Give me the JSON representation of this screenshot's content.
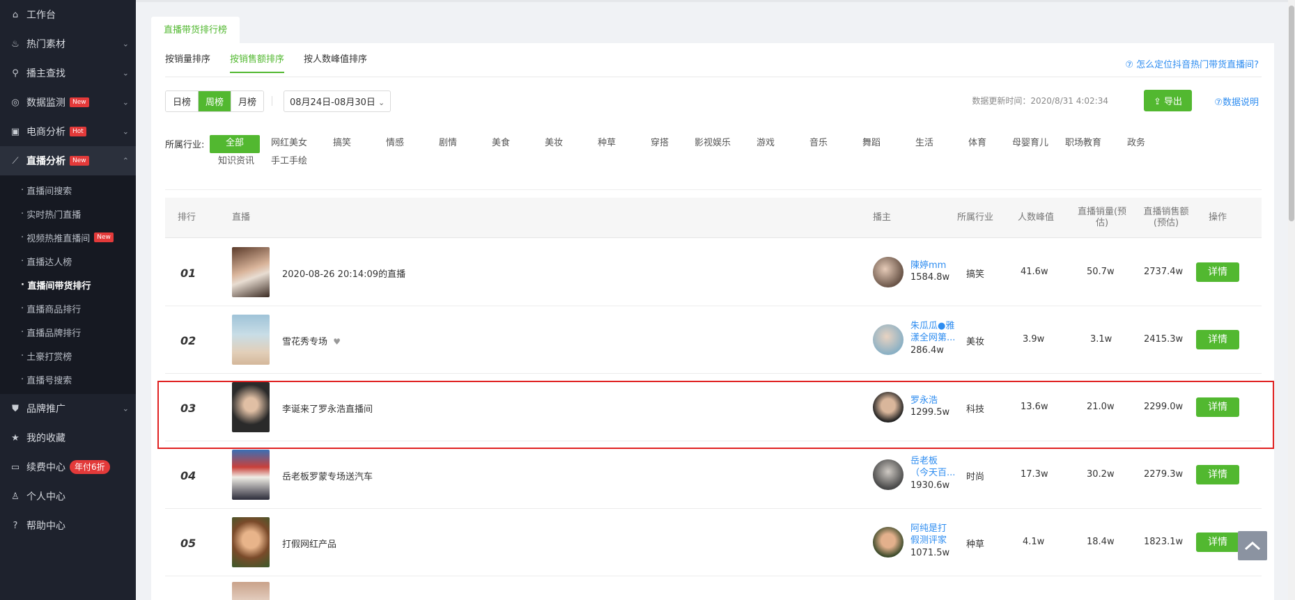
{
  "sidebar": {
    "workspace": "工作台",
    "hot_material": "热门素材",
    "anchor_search": "播主查找",
    "data_monitor": "数据监测",
    "data_monitor_badge": "New",
    "ecom_analysis": "电商分析",
    "ecom_badge": "Hot",
    "live_analysis": "直播分析",
    "live_badge": "New",
    "sub_items": [
      "直播间搜索",
      "实时热门直播",
      "视频热推直播间",
      "直播达人榜",
      "直播间带货排行",
      "直播商品排行",
      "直播品牌排行",
      "土豪打赏榜",
      "直播号搜索"
    ],
    "sub_badge": "New",
    "brand_promo": "品牌推广",
    "favorites": "我的收藏",
    "renew": "续费中心",
    "renew_badge": "年付6折",
    "personal": "个人中心",
    "help": "帮助中心"
  },
  "page": {
    "top_tab": "直播带货排行榜",
    "sort_tabs": [
      "按销量排序",
      "按销售额排序",
      "按人数峰值排序"
    ],
    "howto_link": "⑦ 怎么定位抖音热门带货直播间?",
    "period_buttons": [
      "日榜",
      "周榜",
      "月榜"
    ],
    "date_range": "08月24日-08月30日",
    "update_time": "数据更新时间：2020/8/31 4:02:34",
    "export_label": "导出",
    "explain_link": "⑦数据说明",
    "industry_label": "所属行业:",
    "industries": [
      "全部",
      "网红美女",
      "搞笑",
      "情感",
      "剧情",
      "美食",
      "美妆",
      "种草",
      "穿搭",
      "影视娱乐",
      "游戏",
      "音乐",
      "舞蹈",
      "生活",
      "体育",
      "母婴育儿",
      "职场教育",
      "政务",
      "知识资讯",
      "手工手绘"
    ]
  },
  "table": {
    "headers": {
      "rank": "排行",
      "live": "直播",
      "anchor": "播主",
      "industry": "所属行业",
      "peak": "人数峰值",
      "sales_line1": "直播销量(预",
      "sales_line2": "估)",
      "amount_line1": "直播销售额",
      "amount_line2": "(预估)",
      "op": "操作"
    },
    "detail_label": "详情",
    "rows": [
      {
        "rank": "01",
        "title": "2020-08-26 20:14:09的直播",
        "anchor_l1": "陳婷mm",
        "anchor_l2": "",
        "fans": "1584.8w",
        "industry": "搞笑",
        "peak": "41.6w",
        "sales": "50.7w",
        "amount": "2737.4w"
      },
      {
        "rank": "02",
        "title": "雪花秀专场",
        "anchor_l1": "朱瓜瓜●雅",
        "anchor_l2": "漾全网第...",
        "fans": "286.4w",
        "industry": "美妆",
        "peak": "3.9w",
        "sales": "3.1w",
        "amount": "2415.3w"
      },
      {
        "rank": "03",
        "title": "李诞来了罗永浩直播间",
        "anchor_l1": "罗永浩",
        "anchor_l2": "",
        "fans": "1299.5w",
        "industry": "科技",
        "peak": "13.6w",
        "sales": "21.0w",
        "amount": "2299.0w"
      },
      {
        "rank": "04",
        "title": "岳老板罗蒙专场送汽车",
        "anchor_l1": "岳老板",
        "anchor_l2": "（今天百...",
        "fans": "1930.6w",
        "industry": "时尚",
        "peak": "17.3w",
        "sales": "30.2w",
        "amount": "2279.3w"
      },
      {
        "rank": "05",
        "title": "打假网红产品",
        "anchor_l1": "阿纯是打",
        "anchor_l2": "假测评家",
        "fans": "1071.5w",
        "industry": "种草",
        "peak": "4.1w",
        "sales": "18.4w",
        "amount": "1823.1w"
      }
    ]
  },
  "colors": {
    "accent": "#52b830",
    "link": "#2d8cf0",
    "sidebar": "#1e222d",
    "highlight": "#e02020"
  }
}
